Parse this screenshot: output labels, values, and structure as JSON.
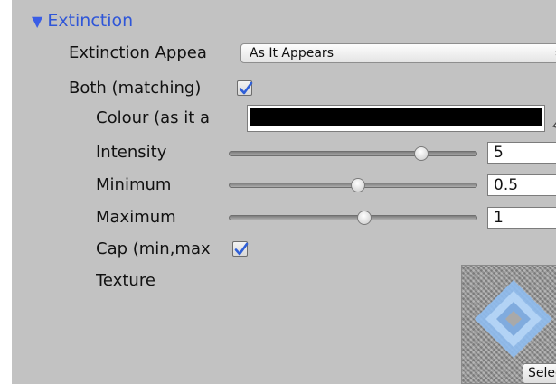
{
  "section": {
    "title": "Extinction",
    "expanded": true
  },
  "fields": {
    "appearance": {
      "label": "Extinction Appea",
      "value": "As It Appears"
    },
    "both_matching": {
      "label": "Both (matching)",
      "checked": true
    },
    "colour": {
      "label": "Colour (as it a",
      "color": "#000000"
    },
    "intensity": {
      "label": "Intensity",
      "value": "5",
      "slider_fraction": 0.79
    },
    "minimum": {
      "label": "Minimum",
      "value": "0.5",
      "slider_fraction": 0.52
    },
    "maximum": {
      "label": "Maximum",
      "value": "1",
      "slider_fraction": 0.55
    },
    "cap": {
      "label": "Cap (min,max",
      "checked": true
    },
    "texture": {
      "label": "Texture",
      "select_label": "Select"
    }
  },
  "colors": {
    "panel_bg": "#c2c2c2",
    "section_title": "#2f56d8",
    "checkmark": "#2f5fd8",
    "colour_swatch": "#000000"
  },
  "icons": {
    "foldout": "triangle-down-icon",
    "dropdown": "updown-arrows-icon",
    "colour_picker": "eyedropper-icon",
    "checkbox": "checkmark-icon"
  }
}
